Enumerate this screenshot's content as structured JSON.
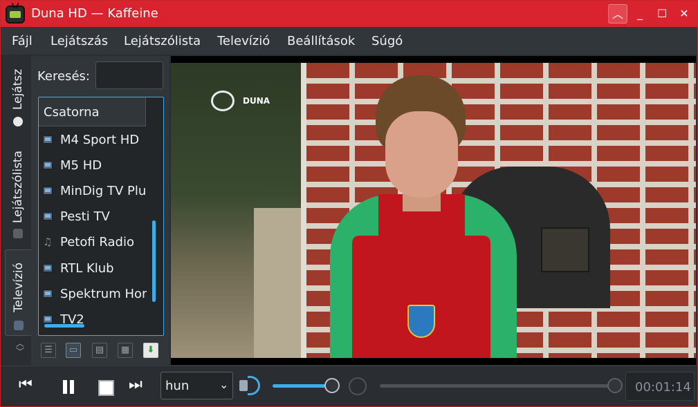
{
  "window": {
    "title": "Duna HD — Kaffeine",
    "accent": "#d9232f"
  },
  "titlebar": {
    "keep_above_icon": "chevron-up-icon",
    "minimize_icon": "minimize-icon",
    "maximize_icon": "maximize-icon",
    "close_icon": "close-icon"
  },
  "menu": [
    {
      "label": "Fájl"
    },
    {
      "label": "Lejátszás"
    },
    {
      "label": "Lejátszólista"
    },
    {
      "label": "Televízió"
    },
    {
      "label": "Beállítások"
    },
    {
      "label": "Súgó"
    }
  ],
  "sidebar_tabs": [
    {
      "label": "Lejátsz",
      "icon": "play-disc-icon"
    },
    {
      "label": "Lejátszólista",
      "icon": "playlist-icon"
    },
    {
      "label": "Televízió",
      "icon": "tv-icon",
      "active": true
    }
  ],
  "search": {
    "label": "Keresés:",
    "value": ""
  },
  "channel_list": {
    "header": "Csatorna",
    "rows": [
      {
        "name": "M4 Sport HD",
        "icon": "tv-icon"
      },
      {
        "name": "M5 HD",
        "icon": "tv-icon"
      },
      {
        "name": "MinDig TV Plu",
        "icon": "tv-icon"
      },
      {
        "name": "Pesti TV",
        "icon": "tv-icon"
      },
      {
        "name": "Petofi Radio",
        "icon": "radio-icon"
      },
      {
        "name": "RTL Klub",
        "icon": "tv-icon"
      },
      {
        "name": "Spektrum Hor",
        "icon": "tv-icon"
      },
      {
        "name": "TV2",
        "icon": "tv-icon"
      }
    ]
  },
  "video": {
    "logo_text": "DUNA"
  },
  "controls": {
    "audio_language": "hun",
    "volume_fraction": 0.85,
    "seek_fraction": 1.0,
    "time": "00:01:14"
  }
}
